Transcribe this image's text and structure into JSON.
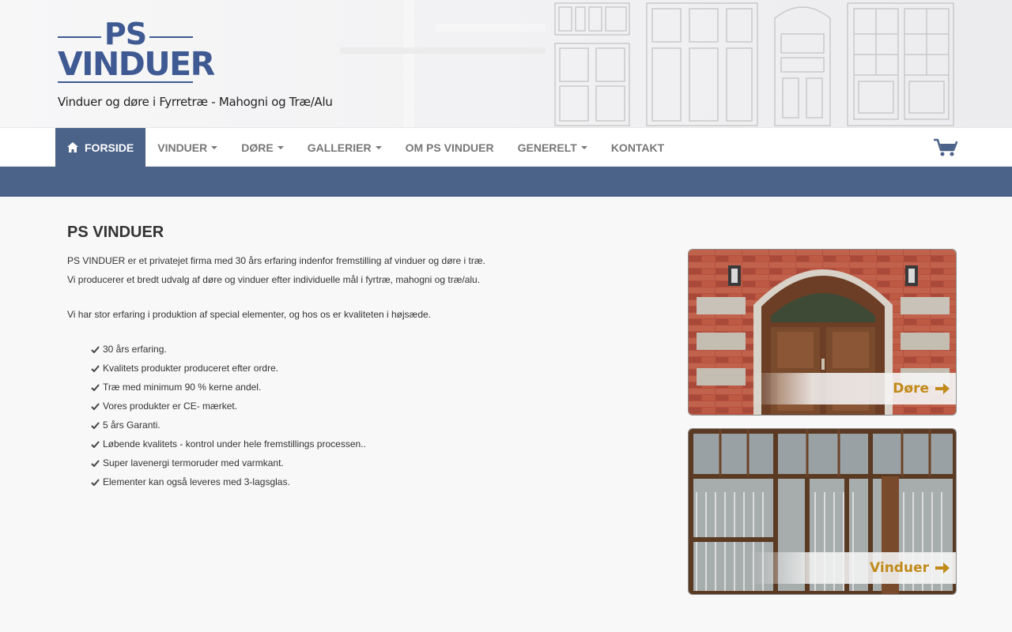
{
  "header": {
    "logo_top": "PS",
    "logo_main": "VINDUER",
    "tagline": "Vinduer og døre i Fyrretræ - Mahogni og Træ/Alu"
  },
  "nav": {
    "items": [
      {
        "label": "FORSIDE",
        "active": true,
        "icon": "home-icon"
      },
      {
        "label": "VINDUER",
        "dropdown": true
      },
      {
        "label": "DØRE",
        "dropdown": true
      },
      {
        "label": "GALLERIER",
        "dropdown": true
      },
      {
        "label": "OM PS VINDUER"
      },
      {
        "label": "GENERELT",
        "dropdown": true
      },
      {
        "label": "KONTAKT"
      }
    ],
    "cart_icon": "shopping-cart-icon"
  },
  "colors": {
    "brand_blue": "#4b6289",
    "logo_blue": "#3f5a92",
    "accent_gold": "#c18a1a"
  },
  "main": {
    "title": "PS VINDUER",
    "paragraphs": [
      "PS VINDUER er et privatejet firma med 30 års erfaring indenfor fremstilling af vinduer og døre i træ.",
      "Vi producerer et bredt udvalg af døre og vinduer efter individuelle mål i fyrtræ, mahogni og træ/alu.",
      "Vi har stor erfaring i produktion af special elementer, og hos os er kvaliteten i højsæde."
    ],
    "features": [
      "30 års erfaring.",
      "Kvalitets produkter produceret efter ordre.",
      "Træ med minimum 90 % kerne andel.",
      "Vores produkter er CE- mærket.",
      "5 års Garanti.",
      "Løbende kvalitets - kontrol under hele fremstillings processen..",
      "Super lavenergi termoruder med varmkant.",
      "Elementer kan også leveres med 3-lagsglas."
    ]
  },
  "panels": [
    {
      "label": "Døre"
    },
    {
      "label": "Vinduer"
    }
  ]
}
